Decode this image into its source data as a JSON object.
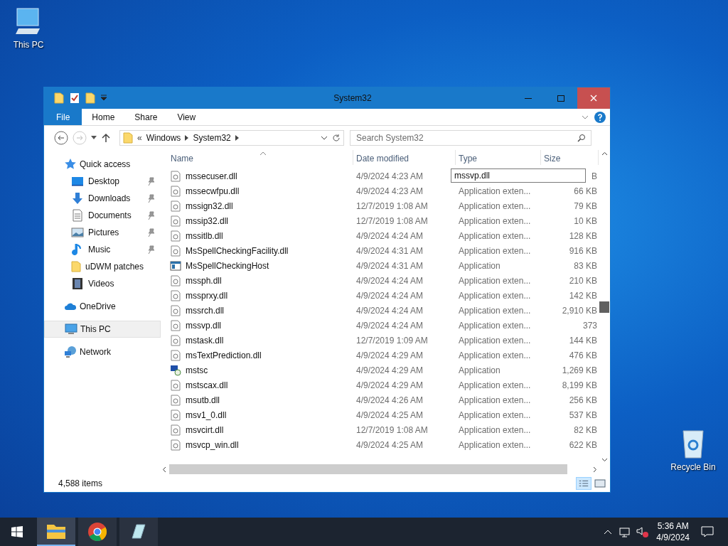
{
  "desktop_icons": [
    {
      "kind": "pc",
      "label": "This PC"
    },
    {
      "kind": "bin",
      "label": "Recycle Bin"
    }
  ],
  "window": {
    "title": "System32",
    "ribbon_tabs": [
      {
        "kind": "file",
        "label": "File",
        "selected": false
      },
      {
        "kind": "tab",
        "label": "Home",
        "selected": false
      },
      {
        "kind": "tab",
        "label": "Share",
        "selected": false
      },
      {
        "kind": "tab",
        "label": "View",
        "selected": false
      }
    ],
    "address": {
      "overflow": "«",
      "crumbs": [
        "Windows",
        "System32"
      ]
    },
    "search": {
      "placeholder": "Search System32"
    },
    "sidebar": [
      {
        "kind": "star",
        "label": "Quick access",
        "selected": false,
        "children": [
          {
            "kind": "desktop",
            "label": "Desktop",
            "pinned": true
          },
          {
            "kind": "download",
            "label": "Downloads",
            "pinned": true
          },
          {
            "kind": "document",
            "label": "Documents",
            "pinned": true
          },
          {
            "kind": "picture",
            "label": "Pictures",
            "pinned": true
          },
          {
            "kind": "music",
            "label": "Music",
            "pinned": true
          },
          {
            "kind": "folder",
            "label": "uDWM patches",
            "pinned": false
          },
          {
            "kind": "video",
            "label": "Videos",
            "pinned": false
          }
        ]
      },
      {
        "kind": "cloud",
        "label": "OneDrive",
        "selected": false
      },
      {
        "kind": "pc",
        "label": "This PC",
        "selected": true
      },
      {
        "kind": "network",
        "label": "Network",
        "selected": false
      }
    ],
    "columns": [
      {
        "label": "Name",
        "sorted": true
      },
      {
        "label": "Date modified",
        "sorted": false
      },
      {
        "label": "Type",
        "sorted": false
      },
      {
        "label": "Size",
        "sorted": false
      }
    ],
    "rows": [
      {
        "kind": "dll",
        "name": "mssecuser.dll",
        "date": "4/9/2024 4:23 AM",
        "type": "",
        "size": "B"
      },
      {
        "kind": "dll",
        "name": "mssecwfpu.dll",
        "date": "4/9/2024 4:23 AM",
        "type": "Application exten...",
        "size": "66 KB"
      },
      {
        "kind": "dll",
        "name": "mssign32.dll",
        "date": "12/7/2019 1:08 AM",
        "type": "Application exten...",
        "size": "79 KB"
      },
      {
        "kind": "dll",
        "name": "mssip32.dll",
        "date": "12/7/2019 1:08 AM",
        "type": "Application exten...",
        "size": "10 KB"
      },
      {
        "kind": "dll",
        "name": "mssitlb.dll",
        "date": "4/9/2024 4:24 AM",
        "type": "Application exten...",
        "size": "128 KB"
      },
      {
        "kind": "dll",
        "name": "MsSpellCheckingFacility.dll",
        "date": "4/9/2024 4:31 AM",
        "type": "Application exten...",
        "size": "916 KB"
      },
      {
        "kind": "app",
        "name": "MsSpellCheckingHost",
        "date": "4/9/2024 4:31 AM",
        "type": "Application",
        "size": "83 KB"
      },
      {
        "kind": "dll",
        "name": "mssph.dll",
        "date": "4/9/2024 4:24 AM",
        "type": "Application exten...",
        "size": "210 KB"
      },
      {
        "kind": "dll",
        "name": "mssprxy.dll",
        "date": "4/9/2024 4:24 AM",
        "type": "Application exten...",
        "size": "142 KB"
      },
      {
        "kind": "dll",
        "name": "mssrch.dll",
        "date": "4/9/2024 4:24 AM",
        "type": "Application exten...",
        "size": "2,910 KB"
      },
      {
        "kind": "dll",
        "name": "mssvp.dll",
        "date": "4/9/2024 4:24 AM",
        "type": "Application exten...",
        "size": "373"
      },
      {
        "kind": "dll",
        "name": "mstask.dll",
        "date": "12/7/2019 1:09 AM",
        "type": "Application exten...",
        "size": "144 KB"
      },
      {
        "kind": "dll",
        "name": "msTextPrediction.dll",
        "date": "4/9/2024 4:29 AM",
        "type": "Application exten...",
        "size": "476 KB"
      },
      {
        "kind": "remote",
        "name": "mstsc",
        "date": "4/9/2024 4:29 AM",
        "type": "Application",
        "size": "1,269 KB"
      },
      {
        "kind": "dll",
        "name": "mstscax.dll",
        "date": "4/9/2024 4:29 AM",
        "type": "Application exten...",
        "size": "8,199 KB"
      },
      {
        "kind": "dll",
        "name": "msutb.dll",
        "date": "4/9/2024 4:26 AM",
        "type": "Application exten...",
        "size": "256 KB"
      },
      {
        "kind": "dll",
        "name": "msv1_0.dll",
        "date": "4/9/2024 4:25 AM",
        "type": "Application exten...",
        "size": "537 KB"
      },
      {
        "kind": "dll",
        "name": "msvcirt.dll",
        "date": "12/7/2019 1:08 AM",
        "type": "Application exten...",
        "size": "82 KB"
      },
      {
        "kind": "dll",
        "name": "msvcp_win.dll",
        "date": "4/9/2024 4:25 AM",
        "type": "Application exten...",
        "size": "622 KB"
      }
    ],
    "rename_field": {
      "value": "mssvp.dll"
    },
    "status": "4,588 items"
  },
  "taskbar": {
    "apps": [
      {
        "kind": "explorer",
        "selected": true
      },
      {
        "kind": "browser",
        "selected": false
      },
      {
        "kind": "notepad",
        "selected": false
      }
    ],
    "time": "5:36 AM",
    "date": "4/9/2024"
  }
}
